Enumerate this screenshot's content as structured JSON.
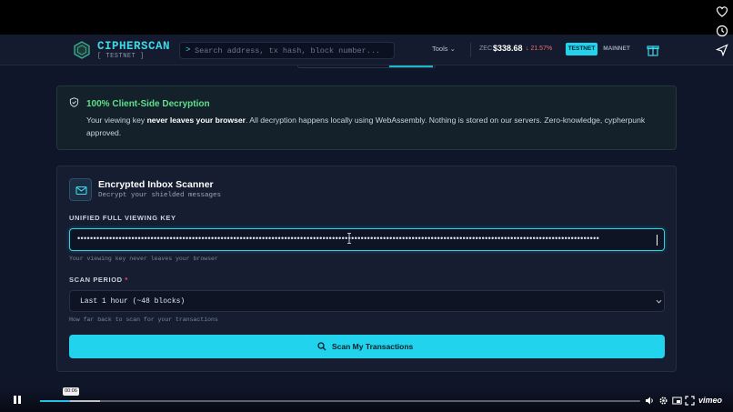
{
  "app": {
    "brand": "CIPHERSCAN",
    "network_tag": "[ TESTNET ]"
  },
  "header": {
    "search_prompt": ">",
    "search_placeholder": "Search address, tx hash, block number...",
    "tools_label": "Tools",
    "ticker": "ZEC",
    "price": "$338.68",
    "change": "↓ 21.57%",
    "networks": [
      "TESTNET",
      "MAINNET"
    ],
    "active_network": "TESTNET"
  },
  "notice": {
    "title": "100% Client-Side Decryption",
    "body_pre": "Your viewing key ",
    "body_bold": "never leaves your browser",
    "body_post": ". All decryption happens locally using WebAssembly. Nothing is stored on our servers. Zero-knowledge, cypherpunk approved."
  },
  "scanner": {
    "title": "Encrypted Inbox Scanner",
    "subtitle": "Decrypt your shielded messages",
    "key_label": "UNIFIED FULL VIEWING KEY",
    "key_masked": "••••••••••••••••••••••••••••••••••••••••••••••••••••••••••••••••••••••••••••••••••••••••••••••••••••••••••••••••••••••••••••••••••••••••••••••••••••••••••••••••••••",
    "key_hint": "Your viewing key never leaves your browser",
    "period_label": "SCAN PERIOD",
    "period_required": "*",
    "period_value": "Last 1 hour (~48 blocks)",
    "period_hint": "How far back to scan for your transactions",
    "scan_button": "Scan My Transactions"
  },
  "player": {
    "time_tooltip": "00:06",
    "brand": "vimeo",
    "progress_played": 0.05,
    "progress_buffered": 0.1
  },
  "colors": {
    "accent": "#22d3ee",
    "success": "#5ee08a",
    "danger": "#ef6b6b"
  }
}
